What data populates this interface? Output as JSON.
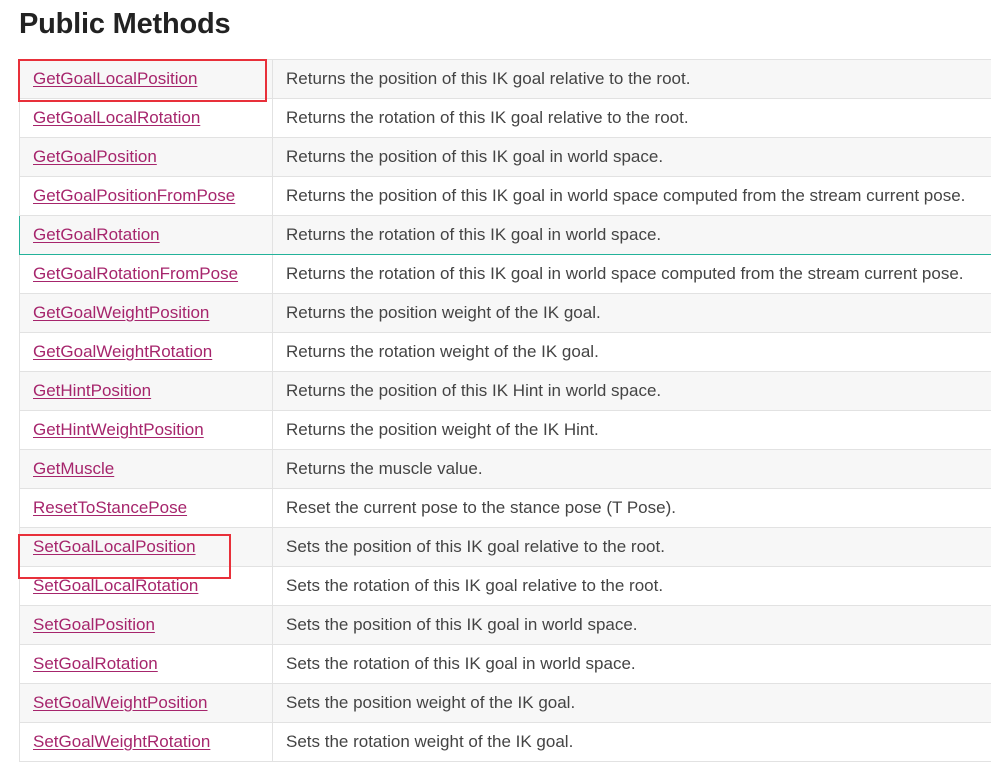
{
  "page": {
    "title": "Public Methods"
  },
  "methods": [
    {
      "name": "GetGoalLocalPosition",
      "description": "Returns the position of this IK goal relative to the root."
    },
    {
      "name": "GetGoalLocalRotation",
      "description": "Returns the rotation of this IK goal relative to the root."
    },
    {
      "name": "GetGoalPosition",
      "description": "Returns the position of this IK goal in world space."
    },
    {
      "name": "GetGoalPositionFromPose",
      "description": "Returns the position of this IK goal in world space computed from the stream current pose."
    },
    {
      "name": "GetGoalRotation",
      "description": "Returns the rotation of this IK goal in world space."
    },
    {
      "name": "GetGoalRotationFromPose",
      "description": "Returns the rotation of this IK goal in world space computed from the stream current pose."
    },
    {
      "name": "GetGoalWeightPosition",
      "description": "Returns the position weight of the IK goal."
    },
    {
      "name": "GetGoalWeightRotation",
      "description": "Returns the rotation weight of the IK goal."
    },
    {
      "name": "GetHintPosition",
      "description": "Returns the position of this IK Hint in world space."
    },
    {
      "name": "GetHintWeightPosition",
      "description": "Returns the position weight of the IK Hint."
    },
    {
      "name": "GetMuscle",
      "description": "Returns the muscle value."
    },
    {
      "name": "ResetToStancePose",
      "description": "Reset the current pose to the stance pose (T Pose)."
    },
    {
      "name": "SetGoalLocalPosition",
      "description": "Sets the position of this IK goal relative to the root."
    },
    {
      "name": "SetGoalLocalRotation",
      "description": "Sets the rotation of this IK goal relative to the root."
    },
    {
      "name": "SetGoalPosition",
      "description": "Sets the position of this IK goal in world space."
    },
    {
      "name": "SetGoalRotation",
      "description": "Sets the rotation of this IK goal in world space."
    },
    {
      "name": "SetGoalWeightPosition",
      "description": "Sets the position weight of the IK goal."
    },
    {
      "name": "SetGoalWeightRotation",
      "description": "Sets the rotation weight of the IK goal."
    }
  ],
  "colors": {
    "link": "#a6256c",
    "highlight_box": "#e8303a",
    "focus_outline": "#23b29a",
    "row_alt": "#f7f7f7"
  }
}
